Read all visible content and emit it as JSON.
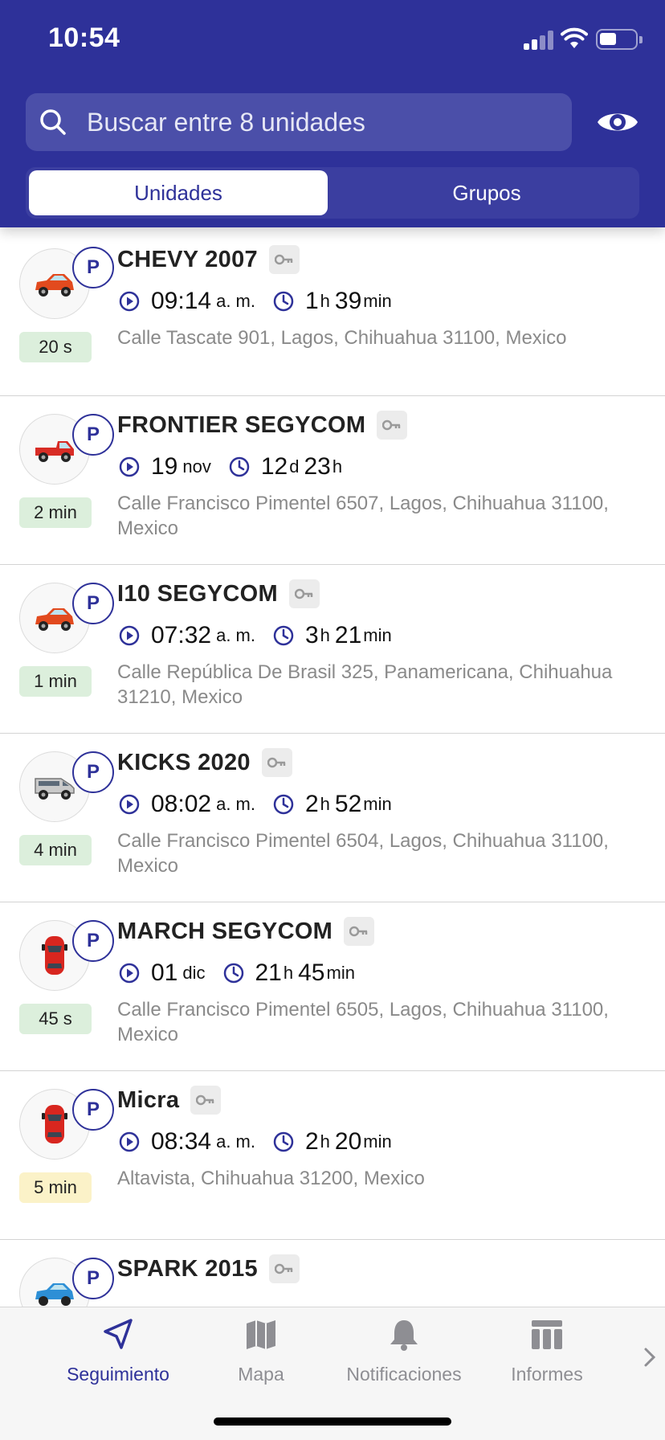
{
  "status_bar": {
    "time": "10:54",
    "battery_level": 0.45
  },
  "search": {
    "placeholder": "Buscar entre 8 unidades",
    "value": ""
  },
  "segments": [
    {
      "label": "Unidades",
      "active": true
    },
    {
      "label": "Grupos",
      "active": false
    }
  ],
  "units": [
    {
      "name": "CHEVY 2007",
      "vehicle_icon": "red-hatchback-side-icon",
      "badge": "P",
      "age": "20 s",
      "age_color": "green",
      "time_main": "09:14",
      "time_suffix": "a. m.",
      "dur_a": "1",
      "dur_a_unit": "h",
      "dur_b": "39",
      "dur_b_unit": "min",
      "address": "Calle Tascate 901, Lagos, Chihuahua 31100, Mexico"
    },
    {
      "name": "FRONTIER SEGYCOM",
      "vehicle_icon": "red-pickup-truck-icon",
      "badge": "P",
      "age": "2 min",
      "age_color": "green",
      "time_main": "19",
      "time_suffix": "nov",
      "dur_a": "12",
      "dur_a_unit": "d",
      "dur_b": "23",
      "dur_b_unit": "h",
      "address": "Calle Francisco Pimentel 6507, Lagos, Chihuahua 31100, Mexico"
    },
    {
      "name": "I10 SEGYCOM",
      "vehicle_icon": "red-hatchback-side-icon",
      "badge": "P",
      "age": "1 min",
      "age_color": "green",
      "time_main": "07:32",
      "time_suffix": "a. m.",
      "dur_a": "3",
      "dur_a_unit": "h",
      "dur_b": "21",
      "dur_b_unit": "min",
      "address": "Calle República De Brasil 325, Panamericana, Chihuahua 31210, Mexico"
    },
    {
      "name": "KICKS 2020",
      "vehicle_icon": "white-van-icon",
      "badge": "P",
      "age": "4 min",
      "age_color": "green",
      "time_main": "08:02",
      "time_suffix": "a. m.",
      "dur_a": "2",
      "dur_a_unit": "h",
      "dur_b": "52",
      "dur_b_unit": "min",
      "address": "Calle Francisco Pimentel 6504, Lagos, Chihuahua 31100, Mexico"
    },
    {
      "name": "MARCH SEGYCOM",
      "vehicle_icon": "red-car-top-view-icon",
      "badge": "P",
      "age": "45 s",
      "age_color": "green",
      "time_main": "01",
      "time_suffix": "dic",
      "dur_a": "21",
      "dur_a_unit": "h",
      "dur_b": "45",
      "dur_b_unit": "min",
      "address": "Calle Francisco Pimentel 6505, Lagos, Chihuahua 31100, Mexico"
    },
    {
      "name": "Micra",
      "vehicle_icon": "red-car-top-view-icon",
      "badge": "P",
      "age": "5 min",
      "age_color": "yellow",
      "time_main": "08:34",
      "time_suffix": "a. m.",
      "dur_a": "2",
      "dur_a_unit": "h",
      "dur_b": "20",
      "dur_b_unit": "min",
      "address": "Altavista, Chihuahua 31200, Mexico"
    },
    {
      "name": "SPARK 2015",
      "vehicle_icon": "blue-hatchback-side-icon",
      "badge": "P",
      "age": "",
      "age_color": "green",
      "time_main": "",
      "time_suffix": "",
      "dur_a": "",
      "dur_a_unit": "",
      "dur_b": "",
      "dur_b_unit": "",
      "address": ""
    }
  ],
  "tabbar": {
    "items": [
      {
        "label": "Seguimiento",
        "icon": "navigation-arrow-icon",
        "active": true
      },
      {
        "label": "Mapa",
        "icon": "map-icon",
        "active": false
      },
      {
        "label": "Notificaciones",
        "icon": "bell-icon",
        "active": false
      },
      {
        "label": "Informes",
        "icon": "table-icon",
        "active": false
      }
    ],
    "more_icon": "chevron-right-icon"
  },
  "colors": {
    "primary": "#2e3199",
    "search_bg": "#4b4fa9",
    "age_green": "#dcefdc",
    "age_yellow": "#fbf2c8",
    "address_gray": "#8a8a8a"
  }
}
